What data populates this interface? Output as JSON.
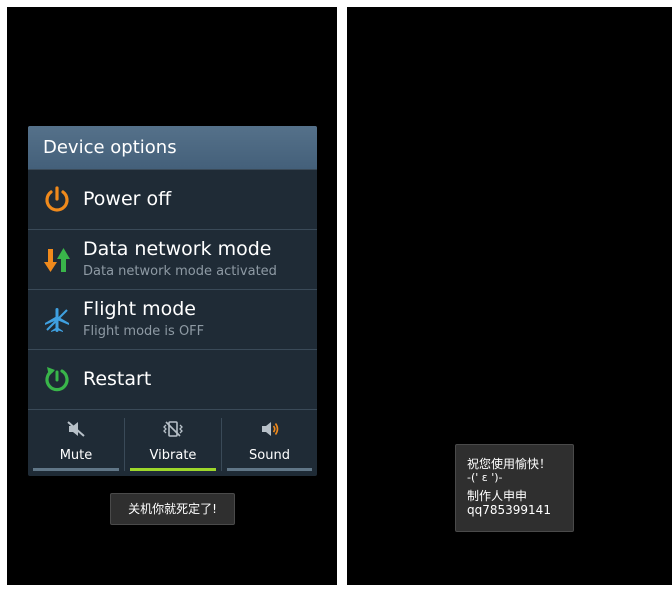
{
  "dialog": {
    "title": "Device options",
    "items": [
      {
        "title": "Power off",
        "subtitle": ""
      },
      {
        "title": "Data network mode",
        "subtitle": "Data network mode activated"
      },
      {
        "title": "Flight mode",
        "subtitle": "Flight mode is OFF"
      },
      {
        "title": "Restart",
        "subtitle": ""
      }
    ],
    "sound_modes": [
      {
        "label": "Mute",
        "icon": "mute-icon"
      },
      {
        "label": "Vibrate",
        "icon": "vibrate-icon",
        "selected": true
      },
      {
        "label": "Sound",
        "icon": "sound-icon"
      }
    ]
  },
  "toast_left": "关机你就死定了!",
  "toast_right": {
    "line1": "祝您使用愉快！",
    "line2": "-(' ε ')-",
    "line3": "制作人申申",
    "line4": "qq785399141"
  },
  "colors": {
    "accent_orange": "#f08a1c",
    "accent_green": "#39b54a",
    "accent_blue": "#3fa0e0",
    "selected_bar": "#9dd72a"
  }
}
